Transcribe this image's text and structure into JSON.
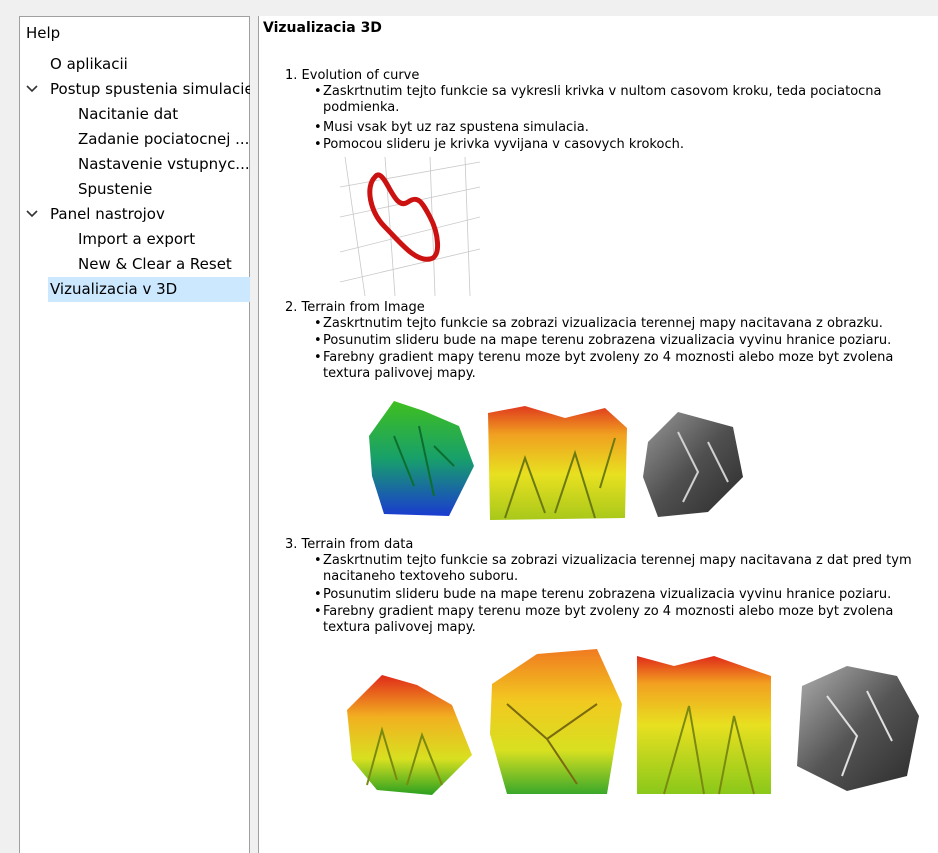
{
  "sidebar": {
    "title": "Help",
    "items": [
      {
        "label": "O aplikacii"
      },
      {
        "label": "Postup spustenia simulacie",
        "icon": "chevron-down-icon"
      },
      {
        "label": "Nacitanie dat"
      },
      {
        "label": "Zadanie pociatocnej ..."
      },
      {
        "label": "Nastavenie vstupnyc..."
      },
      {
        "label": "Spustenie"
      },
      {
        "label": "Panel nastrojov",
        "icon": "chevron-down-icon"
      },
      {
        "label": "Import a export"
      },
      {
        "label": "New & Clear a Reset"
      },
      {
        "label": "Vizualizacia v 3D",
        "selected": true
      }
    ]
  },
  "content": {
    "title": "Vizualizacia 3D",
    "sections": [
      {
        "heading": "1. Evolution of curve",
        "bullets": [
          "Zaskrtnutim tejto funkcie sa vykresli krivka v nultom casovom kroku, teda pociatocna podmienka.",
          "Musi vsak byt uz raz spustena simulacia.",
          "Pomocou slideru je krivka vyvijana v casovych krokoch."
        ]
      },
      {
        "heading": "2. Terrain from Image",
        "bullets": [
          "Zaskrtnutim tejto funkcie sa zobrazi vizualizacia terennej mapy nacitavana z obrazku.",
          "Posunutim slideru bude na mape terenu zobrazena vizualizacia vyvinu hranice poziaru.",
          "Farebny gradient mapy terenu moze byt zvoleny zo 4 moznosti alebo moze byt zvolena textura palivovej mapy."
        ]
      },
      {
        "heading": "3. Terrain from data",
        "bullets": [
          "Zaskrtnutim tejto funkcie sa zobrazi vizualizacia terennej mapy nacitavana z dat pred tym nacitaneho textoveho suboru.",
          "Posunutim slideru bude na mape terenu zobrazena vizualizacia vyvinu hranice poziaru.",
          "Farebny gradient mapy terenu moze byt zvoleny zo 4 moznosti alebo moze byt zvolena textura palivovej mapy."
        ]
      }
    ]
  },
  "colors": {
    "selection": "#cce8ff",
    "border": "#a0a0a0",
    "curve": "#cc1111"
  }
}
